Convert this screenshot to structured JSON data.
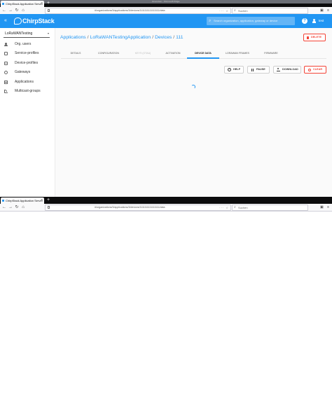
{
  "browser_top": {
    "ghost_title": "Oneruten - Microsoft Edge",
    "tab_title": "ChirpStack Application Server",
    "url": "#/organizations/3/applications/3/devices/1111111111111111/data",
    "search_placeholder": "Suchen"
  },
  "browser_bottom": {
    "tab_title": "ChirpStack Application Server",
    "url": "#/organizations/3/applications/3/devices/1111111111111111/data",
    "search_placeholder": "Suchen"
  },
  "appbar": {
    "brand": "ChirpStack",
    "search_placeholder": "Search organization, application, gateway or device",
    "username": "test",
    "help_glyph": "?",
    "menu_glyph": "«"
  },
  "sidebar": {
    "org_select": "LoRaWANTesting",
    "items": [
      {
        "label": "Org. users",
        "icon": "user-icon"
      },
      {
        "label": "Service-profiles",
        "icon": "service-profile-icon"
      },
      {
        "label": "Device-profiles",
        "icon": "device-profile-icon"
      },
      {
        "label": "Gateways",
        "icon": "gateway-icon"
      },
      {
        "label": "Applications",
        "icon": "applications-icon"
      },
      {
        "label": "Multicast-groups",
        "icon": "multicast-icon"
      }
    ]
  },
  "breadcrumb": {
    "applications": "Applications",
    "application": "LoRaWANTestingApplication",
    "devices": "Devices",
    "device": "111",
    "separator": "/"
  },
  "delete_label": "DELETE",
  "tabs": [
    {
      "label": "DETAILS",
      "state": "normal"
    },
    {
      "label": "CONFIGURATION",
      "state": "normal"
    },
    {
      "label": "KEYS (OTAA)",
      "state": "disabled"
    },
    {
      "label": "ACTIVATION",
      "state": "normal"
    },
    {
      "label": "DEVICE DATA",
      "state": "active"
    },
    {
      "label": "LORAWAN FRAMES",
      "state": "normal"
    },
    {
      "label": "FIRMWARE",
      "state": "normal"
    }
  ],
  "actions": {
    "help": "HELP",
    "pause": "PAUSE",
    "download": "DOWNLOAD",
    "clear": "CLEAR"
  },
  "colors": {
    "primary": "#2196f3",
    "danger": "#f44336",
    "tabbar": "#0c0c0d"
  }
}
